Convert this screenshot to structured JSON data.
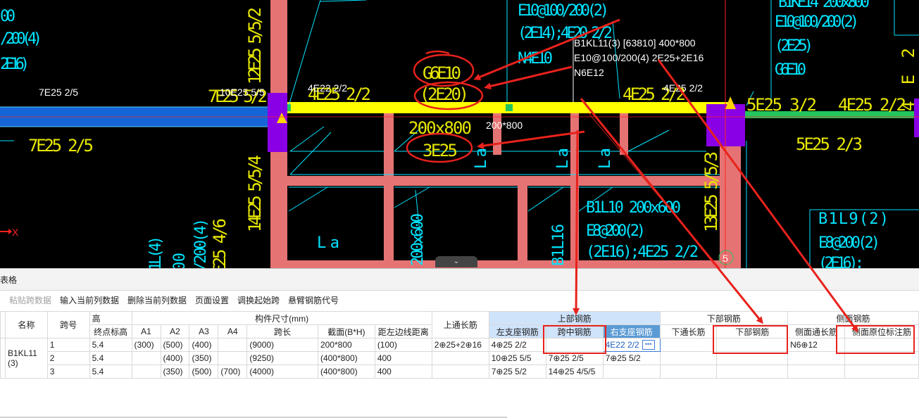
{
  "cad": {
    "beam_label_lines": [
      "B1KL11(3) [63810] 400*800",
      "E10@100/200(4) 2E25+2E16",
      "N6E12"
    ],
    "texts": {
      "t_7e25_25_white": "7E25 2/5",
      "t_7e25_52_yellow": "7E25 5/2",
      "t_10e25_55": "10E25 5/5",
      "t_4e22_22_white": "4E22 2/2",
      "t_4e25_22_yellow_left": "4E25 2/2",
      "t_g6e10": "G6E10",
      "t_2e20": "(2E20)",
      "t_4e25_22_yellow_right": "4E25 2/2",
      "t_4e25_22_white_right": "4E25 2/2",
      "t_5e25_32": "5E25 3/2",
      "t_4e25_22_far": "4E25 2/2",
      "t_7e25_25_yellow": "7E25 2/5",
      "t_200x800": "200x800",
      "t_200x800_white": "200*800",
      "t_3e25": "3E25",
      "t_5e25_23": "5E25 2/3",
      "t_e10_top": "E10@100/200(2)",
      "t_2e14": "(2E14);4E20 2/2",
      "t_n4e10": "N4E10",
      "t_e10_right": "E10@100/200(2)",
      "t_2e25": "(2E25)",
      "t_g6e10_right": "G6E10",
      "t_b1ke14_top": "B1KE14 200x800",
      "t_12e25": "12E25 5/5/2",
      "t_14e25": "14E25 5/5/4",
      "t_13e25": "13E25 5/5/3",
      "t_b1l10": "B1L10 200x600",
      "t_e8_200": "E8@200(2)",
      "t_2e16_4e25": "(2E16);4E25 2/2",
      "t_b1l9": "B1L9(2)",
      "t_e8_200_b": "E8@200(2)",
      "t_2e16_b": "(2E16);",
      "t_b1l16": "B1L16",
      "t_200x600": "200x600",
      "t_la1": "La",
      "t_la2": "La",
      "t_la3": "La",
      "t_la4": "La",
      "t_la5": "La",
      "t_left_00": "00",
      "t_left_200_4": "/200(4)",
      "t_left_2e16": "2E16)",
      "t_axis_x": "X",
      "t_circle5": "5",
      "t_bottom_l4": "1L(4)",
      "t_bottom_200_4": "/200(4)",
      "t_bottom_25_46": "E25 4/6",
      "t_bottom_00": "00",
      "t_bottom_5": "5",
      "t_right_4e2": "4E2"
    }
  },
  "panel": {
    "title": "表格",
    "toolbar": {
      "paste": "粘贴跨数据",
      "input_col": "输入当前列数据",
      "delete_col": "删除当前列数据",
      "page_setup": "页面设置",
      "swap_start": "调换起始跨",
      "cantilever": "悬臂钢筋代号"
    },
    "collapse_icon": "⌄",
    "headers": {
      "name": "名称",
      "span_no": "跨号",
      "elev_group": "高",
      "end_elev": "终点标高",
      "dims_group": "构件尺寸(mm)",
      "a1": "A1",
      "a2": "A2",
      "a3": "A3",
      "a4": "A4",
      "span_len": "跨长",
      "section": "截面(B*H)",
      "offset": "距左边线距离",
      "top_through": "上通长筋",
      "top_group": "上部钢筋",
      "left_support": "左支座钢筋",
      "mid_span": "跨中钢筋",
      "right_support": "右支座钢筋",
      "bottom_group": "下部钢筋",
      "bottom_through": "下通长筋",
      "bottom_rebar": "下部钢筋",
      "side_group": "侧面钢筋",
      "side_through": "侧面通长筋",
      "side_origin": "侧面原位标注筋"
    },
    "name_value": "B1KL11(3)",
    "rows": [
      {
        "span": "1",
        "end_elev": "5.4",
        "a1": "(300)",
        "a2": "(500)",
        "a3": "(400)",
        "a4": "",
        "span_len": "(9000)",
        "section": "200*800",
        "offset": "(100)",
        "top_through": "2⊕25+2⊕16",
        "left_support": "4⊕25 2/2",
        "mid_span": "",
        "right_support": "4E22 2/2",
        "bottom_through": "",
        "bottom_rebar": "",
        "side_through": "N6⊕12",
        "side_origin": ""
      },
      {
        "span": "2",
        "end_elev": "5.4",
        "a1": "",
        "a2": "(400)",
        "a3": "(350)",
        "a4": "",
        "span_len": "(9250)",
        "section": "(400*800)",
        "offset": "400",
        "top_through": "",
        "left_support": "10⊕25 5/5",
        "mid_span": "7⊕25 2/5",
        "right_support": "7⊕25 5/2",
        "bottom_through": "",
        "bottom_rebar": "",
        "side_through": "",
        "side_origin": ""
      },
      {
        "span": "3",
        "end_elev": "5.4",
        "a1": "",
        "a2": "(350)",
        "a3": "(500)",
        "a4": "(700)",
        "span_len": "(4000)",
        "section": "(400*800)",
        "offset": "400",
        "top_through": "",
        "left_support": "7⊕25 5/2",
        "mid_span": "14⊕25 4/5/5",
        "right_support": "",
        "bottom_through": "",
        "bottom_rebar": "",
        "side_through": "",
        "side_origin": ""
      }
    ]
  },
  "colors": {
    "annotation_red": "#e8221c",
    "beam_yellow": "#ffff00",
    "column_purple": "#8a00e6",
    "wall_pink": "#e67373",
    "cad_cyan": "#00e5ff"
  }
}
